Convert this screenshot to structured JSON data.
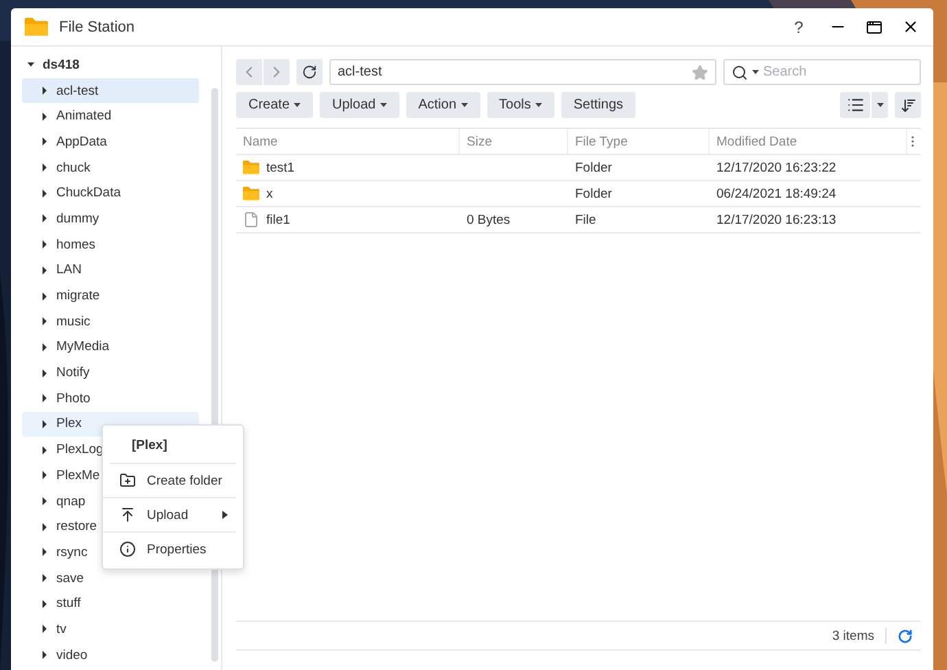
{
  "window": {
    "title": "File Station",
    "help": "?"
  },
  "tree": {
    "root": "ds418",
    "expanded": true,
    "items": [
      {
        "label": "acl-test",
        "selected": true,
        "hovered": false
      },
      {
        "label": "Animated",
        "selected": false,
        "hovered": false
      },
      {
        "label": "AppData",
        "selected": false,
        "hovered": false
      },
      {
        "label": "chuck",
        "selected": false,
        "hovered": false
      },
      {
        "label": "ChuckData",
        "selected": false,
        "hovered": false
      },
      {
        "label": "dummy",
        "selected": false,
        "hovered": false
      },
      {
        "label": "homes",
        "selected": false,
        "hovered": false
      },
      {
        "label": "LAN",
        "selected": false,
        "hovered": false
      },
      {
        "label": "migrate",
        "selected": false,
        "hovered": false
      },
      {
        "label": "music",
        "selected": false,
        "hovered": false
      },
      {
        "label": "MyMedia",
        "selected": false,
        "hovered": false
      },
      {
        "label": "Notify",
        "selected": false,
        "hovered": false
      },
      {
        "label": "Photo",
        "selected": false,
        "hovered": false
      },
      {
        "label": "Plex",
        "selected": false,
        "hovered": true
      },
      {
        "label": "PlexLog",
        "selected": false,
        "hovered": false
      },
      {
        "label": "PlexMe",
        "selected": false,
        "hovered": false
      },
      {
        "label": "qnap",
        "selected": false,
        "hovered": false
      },
      {
        "label": "restore",
        "selected": false,
        "hovered": false
      },
      {
        "label": "rsync",
        "selected": false,
        "hovered": false
      },
      {
        "label": "save",
        "selected": false,
        "hovered": false
      },
      {
        "label": "stuff",
        "selected": false,
        "hovered": false
      },
      {
        "label": "tv",
        "selected": false,
        "hovered": false
      },
      {
        "label": "video",
        "selected": false,
        "hovered": false
      }
    ]
  },
  "path": {
    "value": "acl-test"
  },
  "search": {
    "placeholder": "Search"
  },
  "toolbar": [
    "Create",
    "Upload",
    "Action",
    "Tools"
  ],
  "settings": "Settings",
  "table": {
    "columns": [
      "Name",
      "Size",
      "File Type",
      "Modified Date"
    ],
    "rows": [
      {
        "kind": "folder",
        "name": "test1",
        "size": "",
        "type": "Folder",
        "modified": "12/17/2020 16:23:22"
      },
      {
        "kind": "folder",
        "name": "x",
        "size": "",
        "type": "Folder",
        "modified": "06/24/2021 18:49:24"
      },
      {
        "kind": "file",
        "name": "file1",
        "size": "0 Bytes",
        "type": "File",
        "modified": "12/17/2020 16:23:13"
      }
    ]
  },
  "status": "3 items",
  "context_menu": {
    "title": "[Plex]",
    "items": [
      {
        "kind": "create",
        "label": "Create folder",
        "submenu": false
      },
      {
        "kind": "upload",
        "label": "Upload",
        "submenu": true
      },
      {
        "kind": "info",
        "label": "Properties",
        "submenu": false
      }
    ]
  }
}
